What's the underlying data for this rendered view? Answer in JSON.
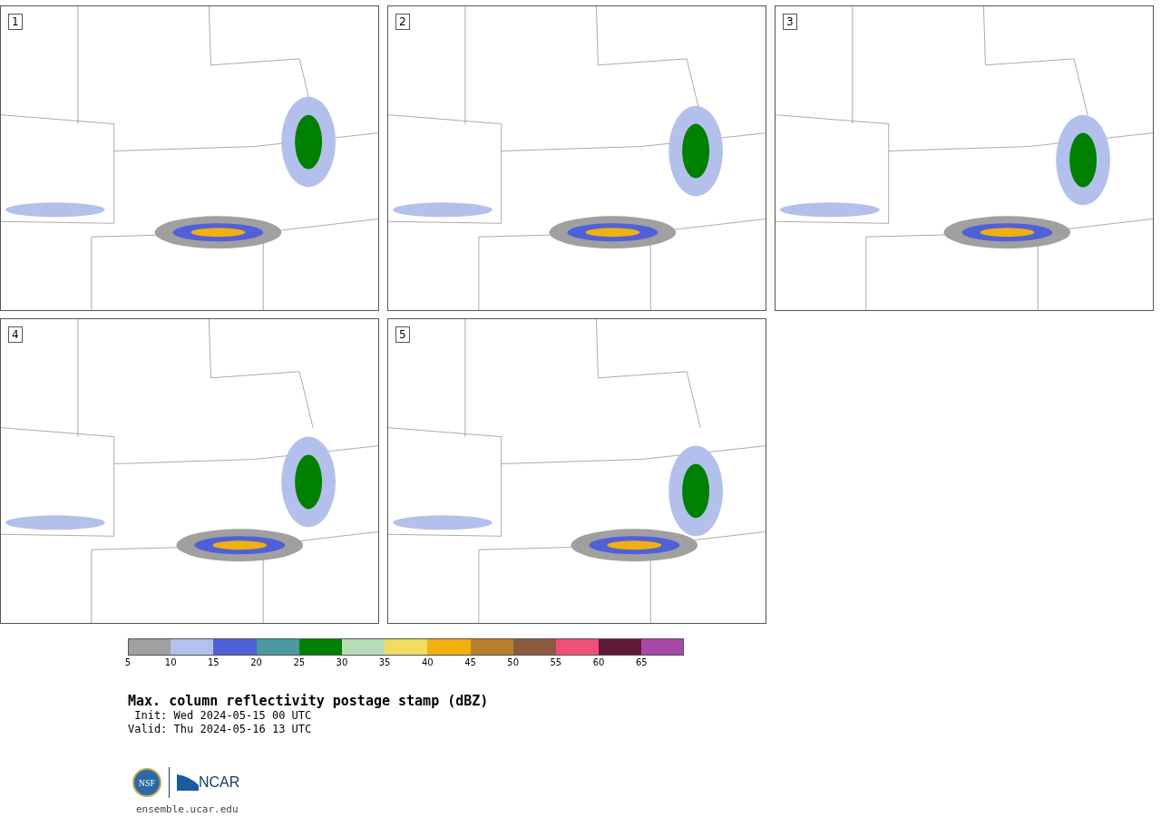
{
  "panels": [
    {
      "label": "1"
    },
    {
      "label": "2"
    },
    {
      "label": "3"
    },
    {
      "label": "4"
    },
    {
      "label": "5"
    }
  ],
  "colorbar": [
    {
      "label": "5",
      "color": "#a0a0a0"
    },
    {
      "label": "10",
      "color": "#b4c0ec"
    },
    {
      "label": "15",
      "color": "#5060d8"
    },
    {
      "label": "20",
      "color": "#4a9aa0"
    },
    {
      "label": "25",
      "color": "#008000"
    },
    {
      "label": "30",
      "color": "#b8dcb8"
    },
    {
      "label": "35",
      "color": "#f0dc60"
    },
    {
      "label": "40",
      "color": "#f0b010"
    },
    {
      "label": "45",
      "color": "#b8802c"
    },
    {
      "label": "50",
      "color": "#8c5a40"
    },
    {
      "label": "55",
      "color": "#f05078"
    },
    {
      "label": "60",
      "color": "#601838"
    },
    {
      "label": "65",
      "color": "#a848a8"
    }
  ],
  "title": "Max. column reflectivity postage stamp (dBZ)",
  "init": " Init: Wed 2024-05-15 00 UTC",
  "valid": "Valid: Thu 2024-05-16 13 UTC",
  "logo": {
    "seal": "NSF",
    "name": "NCAR"
  },
  "footer": "ensemble.ucar.edu"
}
